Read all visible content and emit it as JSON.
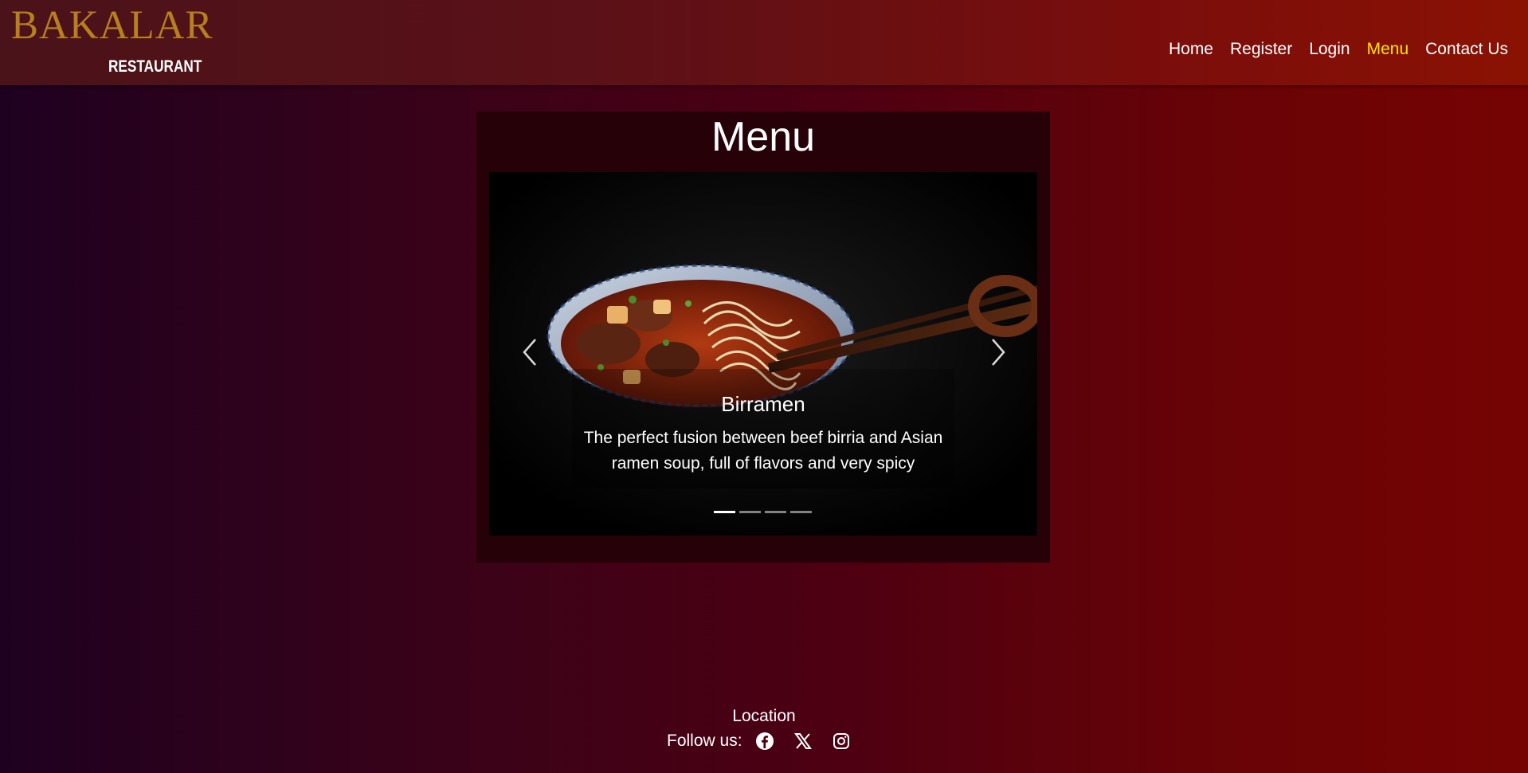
{
  "header": {
    "brand_name": "BAKALAR",
    "brand_sub": "RESTAURANT",
    "nav": [
      {
        "label": "Home"
      },
      {
        "label": "Register"
      },
      {
        "label": "Login"
      },
      {
        "label": "Menu",
        "active": true
      },
      {
        "label": "Contact Us"
      }
    ],
    "active_color": "#ffe600"
  },
  "menu": {
    "title": "Menu",
    "carousel": {
      "active_index": 0,
      "slide_count": 4,
      "slide": {
        "image": "birramen-bowl-with-chopsticks",
        "title": "Birramen",
        "description": "The perfect fusion between beef birria and Asian ramen soup, full of flavors and very spicy"
      },
      "prev_icon": "chevron-left-icon",
      "next_icon": "chevron-right-icon"
    }
  },
  "footer": {
    "location_label": "Location",
    "follow_label": "Follow us:",
    "socials": [
      "facebook-icon",
      "x-icon",
      "instagram-icon"
    ]
  },
  "colors": {
    "brand_gold": "#b77f1e",
    "panel_bg": "#270108"
  }
}
